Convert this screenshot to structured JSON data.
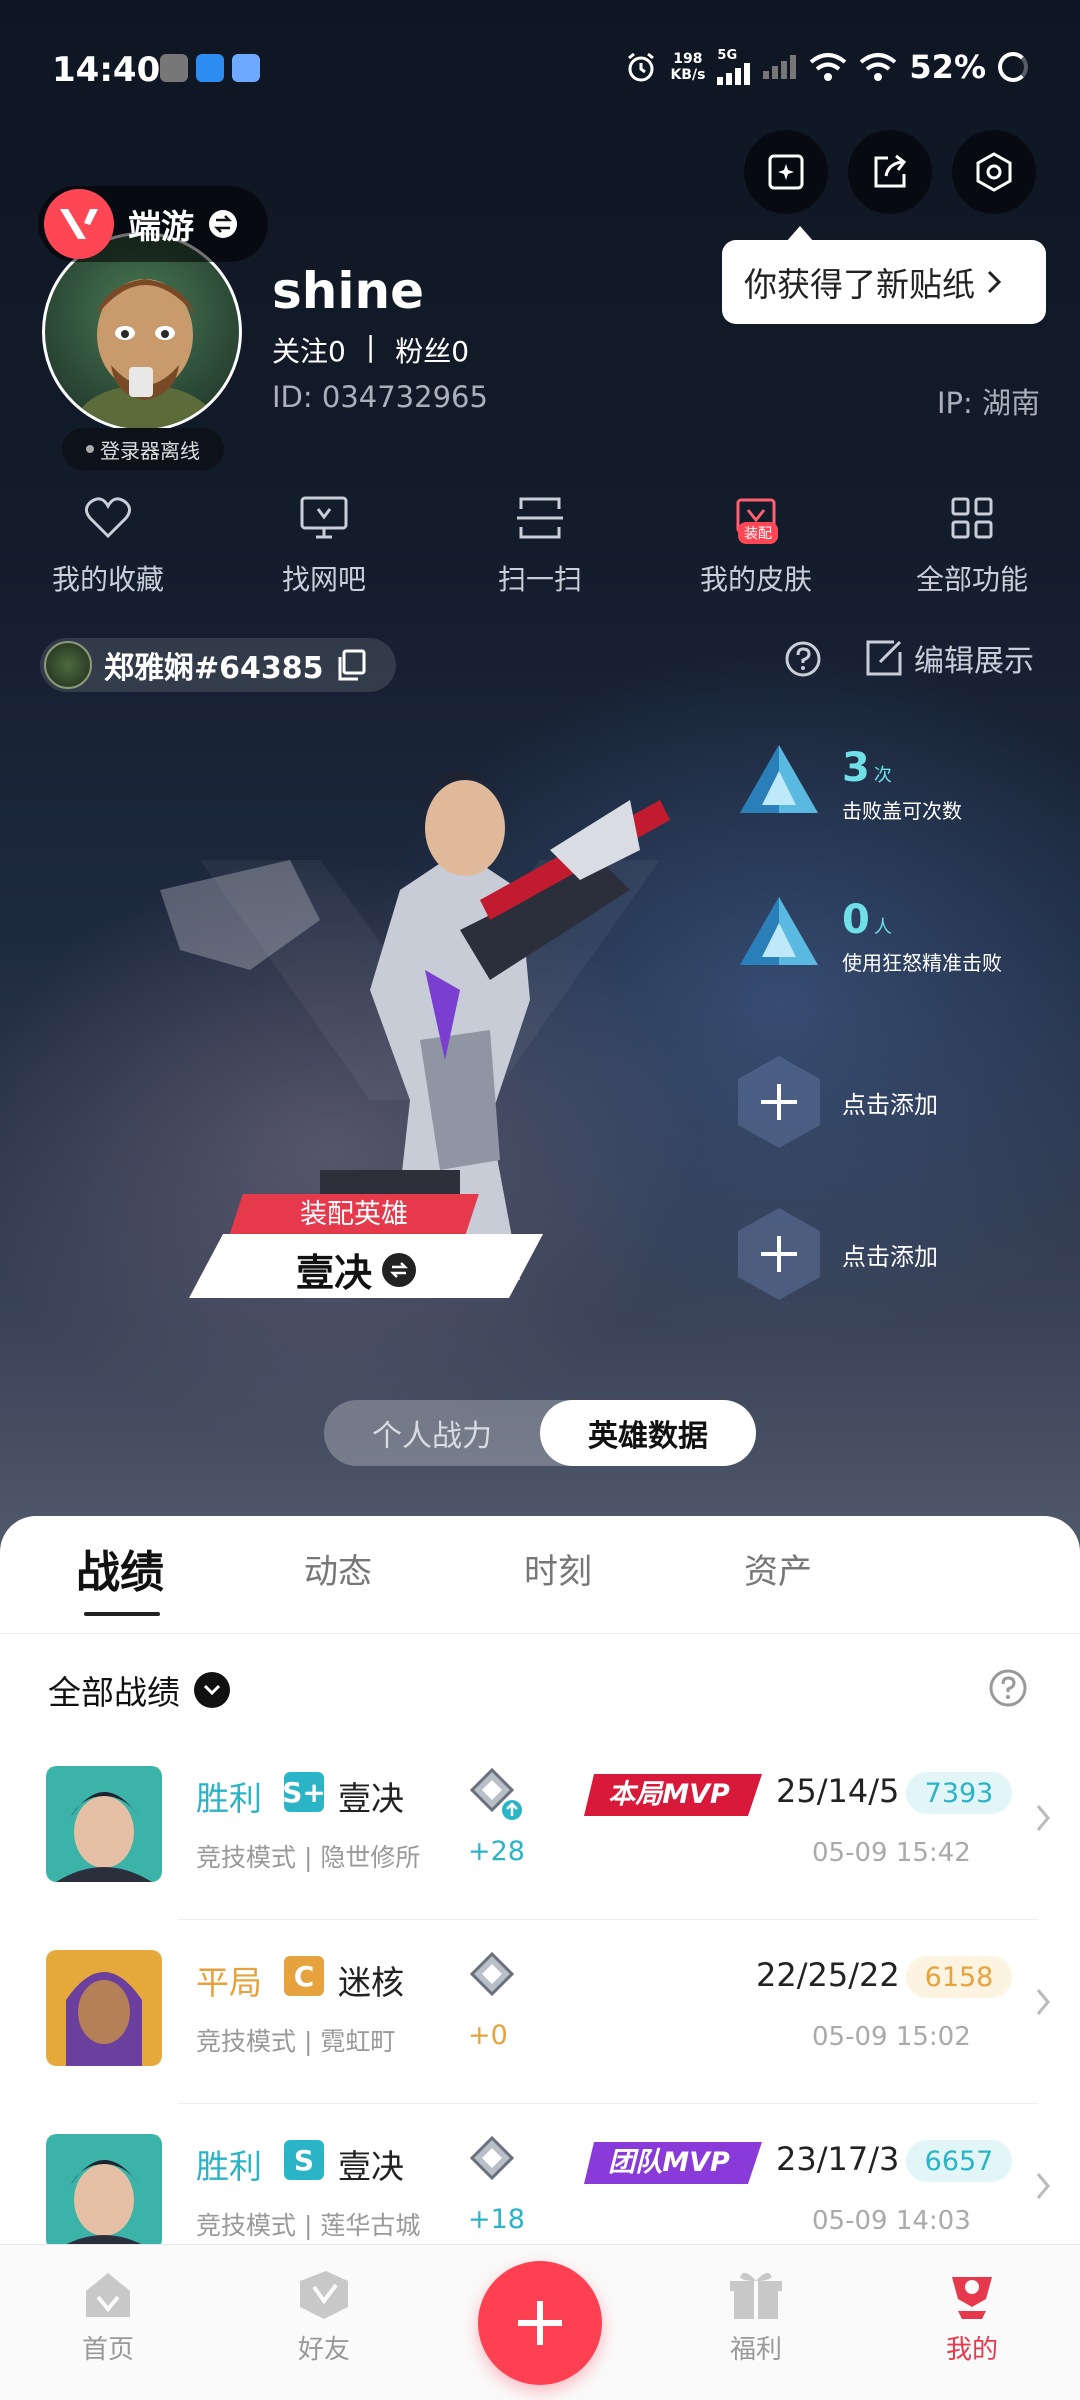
{
  "status_bar": {
    "time": "14:40",
    "net_speed_value": "198",
    "net_speed_unit": "KB/s",
    "network": "5G",
    "battery": "52%"
  },
  "header": {
    "tooltip": "你获得了新贴纸",
    "game_label": "端游",
    "offline_status": "登录器离线",
    "username": "shine",
    "following_label": "关注",
    "following_count": "0",
    "divider": "|",
    "fans_label": "粉丝",
    "fans_count": "0",
    "user_id": "ID:  034732965",
    "ip": "IP:  湖南"
  },
  "quick_functions": [
    {
      "label": "我的收藏",
      "icon": "heart-icon"
    },
    {
      "label": "找网吧",
      "icon": "monitor-icon"
    },
    {
      "label": "扫一扫",
      "icon": "scan-icon"
    },
    {
      "label": "我的皮肤",
      "icon": "skin-icon",
      "badge": "装配"
    },
    {
      "label": "全部功能",
      "icon": "grid-icon"
    }
  ],
  "player": {
    "riot_id": "郑雅娴#64385",
    "edit_label": "编辑展示"
  },
  "hero": {
    "equip_label": "装配英雄",
    "agent_name": "壹决",
    "toggle": {
      "left": "个人战力",
      "right": "英雄数据",
      "active": "right"
    }
  },
  "stats": [
    {
      "value": "3",
      "unit": "次",
      "desc": "击败盖可次数"
    },
    {
      "value": "0",
      "unit": "人",
      "desc": "使用狂怒精准击败"
    },
    {
      "add_label": "点击添加"
    },
    {
      "add_label": "点击添加"
    }
  ],
  "tabs": [
    "战绩",
    "动态",
    "时刻",
    "资产"
  ],
  "filter": {
    "label": "全部战绩"
  },
  "matches": [
    {
      "result": "胜利",
      "result_color": "#2bb3c8",
      "rank": "S+",
      "rank_color": "#2bb3c8",
      "agent": "壹决",
      "mode": "竞技模式 | 隐世修所",
      "rr_delta": "+28",
      "rr_color": "#2bb3c8",
      "mvp": "本局MVP",
      "mvp_color": "#d8193a",
      "kda": "25/14/5",
      "score": "7393",
      "score_bg": "#e3f6f7",
      "score_color": "#2bb3c8",
      "time": "05-09 15:42"
    },
    {
      "result": "平局",
      "result_color": "#e6a23c",
      "rank": "C",
      "rank_color": "#e6a23c",
      "agent": "迷核",
      "mode": "竞技模式 | 霓虹町",
      "rr_delta": "+0",
      "rr_color": "#e6a23c",
      "mvp": "",
      "mvp_color": "",
      "kda": "22/25/22",
      "score": "6158",
      "score_bg": "#fdf3e1",
      "score_color": "#e6a23c",
      "time": "05-09 15:02"
    },
    {
      "result": "胜利",
      "result_color": "#2bb3c8",
      "rank": "S",
      "rank_color": "#2bb3c8",
      "agent": "壹决",
      "mode": "竞技模式 | 莲华古城",
      "rr_delta": "+18",
      "rr_color": "#2bb3c8",
      "mvp": "团队MVP",
      "mvp_color": "#8a3ad8",
      "kda": "23/17/3",
      "score": "6657",
      "score_bg": "#e3f6f7",
      "score_color": "#2bb3c8",
      "time": "05-09 14:03"
    }
  ],
  "bottom_nav": [
    {
      "label": "首页",
      "icon": "home-icon"
    },
    {
      "label": "好友",
      "icon": "friends-icon"
    },
    {
      "label": "",
      "icon": "plus-icon"
    },
    {
      "label": "福利",
      "icon": "gift-icon"
    },
    {
      "label": "我的",
      "icon": "profile-icon",
      "active": true
    }
  ]
}
